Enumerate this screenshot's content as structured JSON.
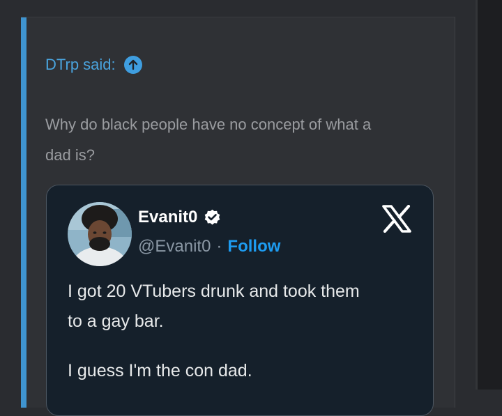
{
  "quote": {
    "author_label": "DTrp said:",
    "text_line1": "Why do black people have no concept of what a",
    "text_line2": "dad is?"
  },
  "embed": {
    "display_name": "Evanit0",
    "handle": "@Evanit0",
    "separator": "·",
    "follow_label": "Follow",
    "tweet_lines": [
      "I got 20 VTubers drunk and took them",
      "to a gay bar.",
      "I guess I'm the con dad."
    ]
  },
  "colors": {
    "quote_accent": "#3f94d0",
    "link": "#4aa4de",
    "embed_bg": "#15202b",
    "follow": "#1d9bf0"
  },
  "icons": [
    "arrow-up-circle-icon",
    "verified-badge-icon",
    "x-logo-icon",
    "avatar"
  ]
}
